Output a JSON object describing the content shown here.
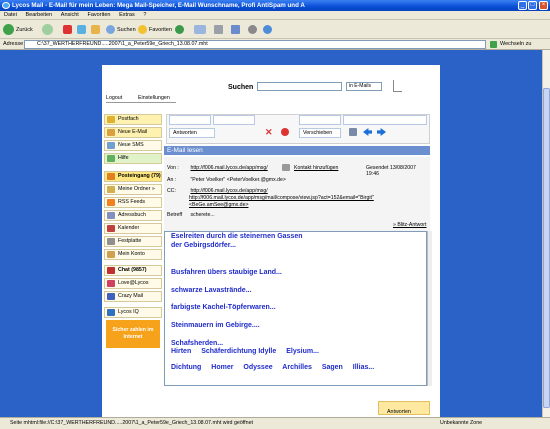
{
  "window": {
    "title": "Lycos Mail - E-Mail für mein Leben: Mega Mail-Speicher, E-Mail Wunschname, Profi AntiSpam und A",
    "controls": [
      "_",
      "□",
      "×"
    ]
  },
  "menu": [
    "Datei",
    "Bearbeiten",
    "Ansicht",
    "Favoriten",
    "Extras",
    "?"
  ],
  "toolbar": {
    "back_label": "Zurück",
    "search_label": "Suchen",
    "favorites_label": "Favoriten"
  },
  "address": {
    "label": "Adresse",
    "value": "C:\\37_WERTHERFREUND.....2007\\1_a_Peter59e_Griech_13.08.07.mht",
    "go_label": "Wechseln zu"
  },
  "header": {
    "logout": "Logout",
    "settings": "Einstellungen",
    "search_title": "Suchen",
    "search_scope": "in E-Mails"
  },
  "nav": [
    {
      "label": "Postfach"
    },
    {
      "label": "Neue E-Mail"
    },
    {
      "label": "Neue SMS"
    },
    {
      "label": "Hilfe"
    },
    {
      "label": "Posteingang (79)"
    },
    {
      "label": "Meine Ordner »"
    },
    {
      "label": "RSS Feeds"
    },
    {
      "label": "Adressbuch"
    },
    {
      "label": "Kalender"
    },
    {
      "label": "Festplatte"
    },
    {
      "label": "Mein Konto"
    },
    {
      "label": "Chat (9857)"
    },
    {
      "label": "Love@Lycos"
    },
    {
      "label": "Crazy Mail"
    },
    {
      "label": "Lycos IQ"
    }
  ],
  "promo": "Sicher zahlen im Internet",
  "mailtool": {
    "reply_label": "Antworten",
    "move_label": "Verschieben"
  },
  "mail": {
    "section_title": "E-Mail lesen",
    "von_label": "Von :",
    "von_value": "http://f006.mail.lycos.de/app/msg/",
    "contact_add": "Kontakt hinzufügen",
    "received": "Gesendet 13/08/2007 19:46",
    "an_label": "An :",
    "an_value": "\"Peter Voelker\" <PeterVoelker.@gmx.de>",
    "cc_label": "CC:",
    "cc_value_1": "http://f006.mail.lycos.de/app/msg/",
    "cc_value_2": "http://f006.mail.lycos.de/app/msg/mail/compose/view.jsp?act=152&email=\"Birgit\"",
    "cc_value_3": "<BeGe.amSee@gmx.de>",
    "subject_label": "Betreff",
    "subject_value": "scherete...",
    "quick_reply": "» Blitz-Antwort"
  },
  "body": {
    "line1": "Eselreiten durch die steinernen Gassen",
    "line2": "der Gebirgsdörfer...",
    "line3": "Busfahren übers staubige Land...",
    "line4": "schwarze Lavastrände...",
    "line5": "farbigste Kachel-Töpferwaren...",
    "line6": "Steinmauern im Gebirge....",
    "line7": "Schafsherden...",
    "row1": [
      "Hirten",
      "Schäferdichtung Idylle",
      "Elysium..."
    ],
    "row2": [
      "Dichtung",
      "Homer",
      "Odyssee",
      "Archilles",
      "Sagen",
      "Illias..."
    ]
  },
  "footer": {
    "reply_label": "Antworten"
  },
  "status": {
    "left": "Seite mhtml:file://C:\\37_WERTHERFREUND.....2007\\1_a_Peter59e_Griech_13.08.07.mht wird geöffnet",
    "zone": "Unbekannte Zone"
  }
}
